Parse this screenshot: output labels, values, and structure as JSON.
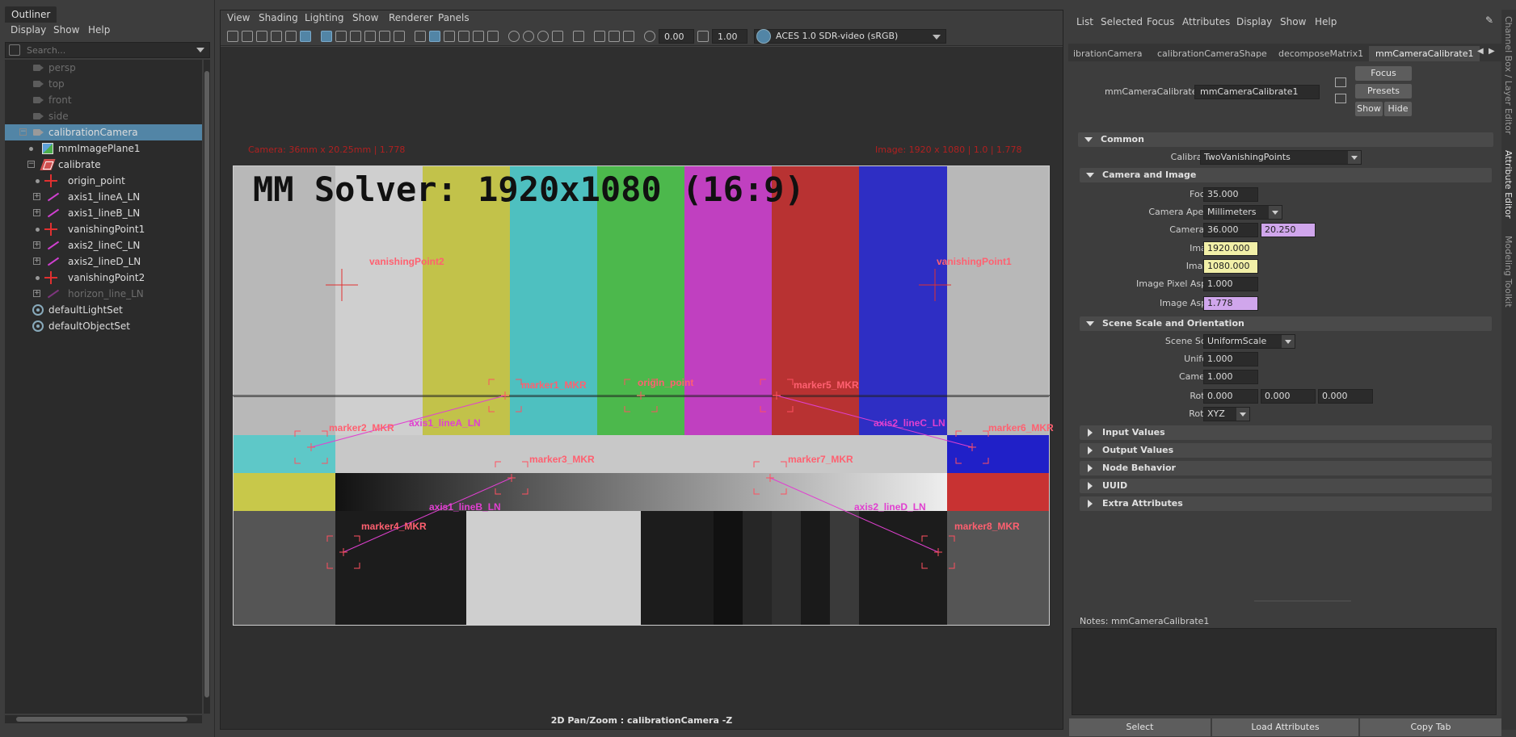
{
  "outliner": {
    "title": "Outliner",
    "menu": [
      "Display",
      "Show",
      "Help"
    ],
    "search_placeholder": "Search...",
    "items": [
      {
        "label": "persp",
        "icon": "camera-icon",
        "dim": true
      },
      {
        "label": "top",
        "icon": "camera-icon",
        "dim": true
      },
      {
        "label": "front",
        "icon": "camera-icon",
        "dim": true
      },
      {
        "label": "side",
        "icon": "camera-icon",
        "dim": true
      },
      {
        "label": "calibrationCamera",
        "icon": "camera-icon",
        "selected": true
      },
      {
        "label": "mmImagePlane1",
        "icon": "image-plane-icon"
      },
      {
        "label": "calibrate",
        "icon": "calibrate-icon"
      },
      {
        "label": "origin_point",
        "icon": "locator-icon"
      },
      {
        "label": "axis1_lineA_LN",
        "icon": "line-icon"
      },
      {
        "label": "axis1_lineB_LN",
        "icon": "line-icon"
      },
      {
        "label": "vanishingPoint1",
        "icon": "locator-icon"
      },
      {
        "label": "axis2_lineC_LN",
        "icon": "line-icon"
      },
      {
        "label": "axis2_lineD_LN",
        "icon": "line-icon"
      },
      {
        "label": "vanishingPoint2",
        "icon": "locator-icon"
      },
      {
        "label": "horizon_line_LN",
        "icon": "line-icon",
        "dim": true
      },
      {
        "label": "defaultLightSet",
        "icon": "set-icon"
      },
      {
        "label": "defaultObjectSet",
        "icon": "set-icon"
      }
    ]
  },
  "viewport": {
    "menu": [
      "View",
      "Shading",
      "Lighting",
      "Show",
      "Renderer",
      "Panels"
    ],
    "toolbar": {
      "exposure": "0.00",
      "gamma": "1.00",
      "color_space": "ACES 1.0 SDR-video (sRGB)"
    },
    "hud_camera": "Camera: 36mm x 20.25mm | 1.778",
    "hud_image": "Image: 1920 x 1080 | 1.0 | 1.778",
    "hud_bottom": "2D Pan/Zoom : calibrationCamera -Z",
    "image_title": "MM Solver: 1920x1080 (16:9)",
    "markers": {
      "vp2": "vanishingPoint2",
      "vp1": "vanishingPoint1",
      "m1": "marker1_MKR",
      "m2": "marker2_MKR",
      "m3": "marker3_MKR",
      "m4": "marker4_MKR",
      "m5": "marker5_MKR",
      "m6": "marker6_MKR",
      "m7": "marker7_MKR",
      "m8": "marker8_MKR",
      "origin": "origin_point"
    },
    "lines": {
      "a": "axis1_lineA_LN",
      "b": "axis1_lineB_LN",
      "c": "axis2_lineC_LN",
      "d": "axis2_lineD_LN"
    },
    "colors": {
      "marker": "#ff6070",
      "line": "#e040d0"
    }
  },
  "attribute_editor": {
    "menu": [
      "List",
      "Selected",
      "Focus",
      "Attributes",
      "Display",
      "Show",
      "Help"
    ],
    "tabs": [
      "ibrationCamera",
      "calibrationCameraShape",
      "decomposeMatrix1",
      "mmCameraCalibrate1"
    ],
    "node_label": "mmCameraCalibrate:",
    "node_name": "mmCameraCalibrate1",
    "buttons": {
      "focus": "Focus",
      "presets": "Presets",
      "show": "Show",
      "hide": "Hide"
    },
    "sections": {
      "common": "Common",
      "camera_image": "Camera and Image",
      "scene_scale": "Scene Scale and Orientation",
      "input_values": "Input Values",
      "output_values": "Output Values",
      "node_behavior": "Node Behavior",
      "uuid": "UUID",
      "extra": "Extra Attributes"
    },
    "fields": {
      "calibration_mode": {
        "label": "Calibration Mode",
        "value": "TwoVanishingPoints"
      },
      "focal_length": {
        "label": "Focal Length",
        "value": "35.000"
      },
      "aperture_unit": {
        "label": "Camera Aperture Unit",
        "value": "Millimeters"
      },
      "aperture": {
        "label": "Camera Aperture",
        "value_x": "36.000",
        "value_y": "20.250"
      },
      "image_width": {
        "label": "Image Width",
        "value": "1920.000"
      },
      "image_height": {
        "label": "Image Height",
        "value": "1080.000"
      },
      "pixel_aspect": {
        "label": "Image Pixel Aspect Ratio",
        "value": "1.000"
      },
      "image_aspect": {
        "label": "Image Aspect Ratio",
        "value": "1.778"
      },
      "scale_mode": {
        "label": "Scene Scale Mode",
        "value": "UniformScale"
      },
      "uniform_scale": {
        "label": "Uniform Scale",
        "value": "1.000"
      },
      "camera_height": {
        "label": "Camera Height",
        "value": "1.000"
      },
      "rotate_plane": {
        "label": "Rotate Plane",
        "x": "0.000",
        "y": "0.000",
        "z": "0.000"
      },
      "rotate_order": {
        "label": "Rotate Order",
        "value": "XYZ"
      }
    },
    "notes_label": "Notes:  mmCameraCalibrate1",
    "bottom_buttons": {
      "select": "Select",
      "load": "Load Attributes",
      "copy": "Copy Tab"
    }
  },
  "side_tabs": [
    "Channel Box / Layer Editor",
    "Attribute Editor",
    "Modeling Toolkit"
  ]
}
